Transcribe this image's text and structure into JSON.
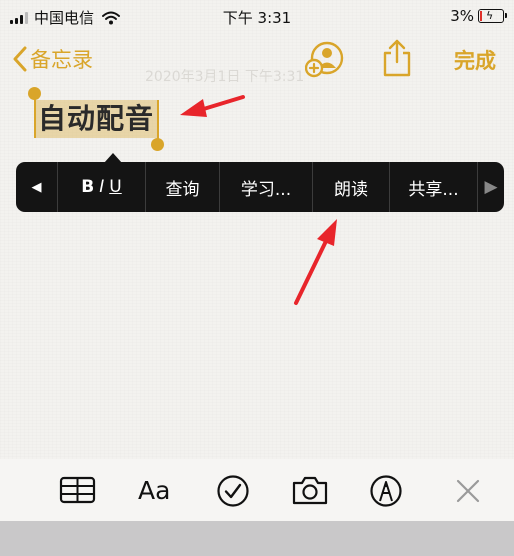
{
  "status_bar": {
    "carrier": "中国电信",
    "time": "下午 3:31",
    "battery": "3%"
  },
  "nav": {
    "back_label": "备忘录",
    "done_label": "完成"
  },
  "note": {
    "faint_date": "2020年3月1日 下午3:31",
    "selected_text": "自动配音"
  },
  "edit_menu": {
    "prev_arrow": "◀",
    "bold": "B",
    "italic": "I",
    "underline": "U",
    "items": [
      "查询",
      "学习...",
      "朗读",
      "共享..."
    ],
    "next_arrow": "▶"
  },
  "toolbar": {
    "text_style_label": "Aa"
  },
  "colors": {
    "accent": "#d9a52a",
    "menu_bg": "#141414",
    "annotation_red": "#e8252b"
  }
}
